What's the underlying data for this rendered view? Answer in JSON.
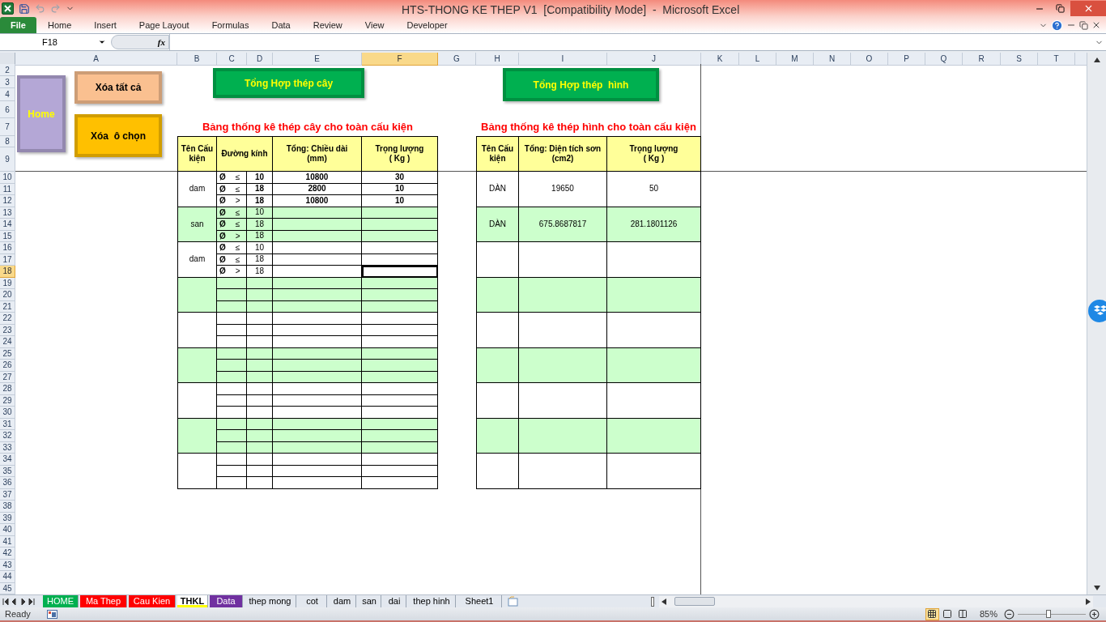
{
  "window": {
    "title": "HTS-THONG KE THEP V1  [Compatibility Mode]  -  Microsoft Excel"
  },
  "ribbon_tabs": [
    {
      "label": "File",
      "kind": "file"
    },
    {
      "label": "Home",
      "kind": "tab"
    },
    {
      "label": "Insert",
      "kind": "tab"
    },
    {
      "label": "Page Layout",
      "kind": "tab"
    },
    {
      "label": "Formulas",
      "kind": "tab"
    },
    {
      "label": "Data",
      "kind": "tab"
    },
    {
      "label": "Review",
      "kind": "tab"
    },
    {
      "label": "View",
      "kind": "tab"
    },
    {
      "label": "Developer",
      "kind": "tab"
    }
  ],
  "formula_bar": {
    "name_box": "F18",
    "function_label": "fx"
  },
  "columns": [
    {
      "label": "A",
      "selected": false
    },
    {
      "label": "B",
      "selected": false
    },
    {
      "label": "C",
      "selected": false
    },
    {
      "label": "D",
      "selected": false
    },
    {
      "label": "E",
      "selected": false
    },
    {
      "label": "F",
      "selected": true
    },
    {
      "label": "G",
      "selected": false
    },
    {
      "label": "H",
      "selected": false
    },
    {
      "label": "I",
      "selected": false
    },
    {
      "label": "J",
      "selected": false
    },
    {
      "label": "K",
      "selected": false
    },
    {
      "label": "L",
      "selected": false
    },
    {
      "label": "M",
      "selected": false
    },
    {
      "label": "N",
      "selected": false
    },
    {
      "label": "O",
      "selected": false
    },
    {
      "label": "P",
      "selected": false
    },
    {
      "label": "Q",
      "selected": false
    },
    {
      "label": "R",
      "selected": false
    },
    {
      "label": "S",
      "selected": false
    },
    {
      "label": "T",
      "selected": false
    }
  ],
  "rows": [
    {
      "label": "2",
      "selected": false
    },
    {
      "label": "3",
      "selected": false
    },
    {
      "label": "4",
      "selected": false
    },
    {
      "label": "6",
      "selected": false
    },
    {
      "label": "7",
      "selected": false
    },
    {
      "label": "8",
      "selected": false
    },
    {
      "label": "9",
      "selected": false
    },
    {
      "label": "10",
      "selected": false
    },
    {
      "label": "11",
      "selected": false
    },
    {
      "label": "12",
      "selected": false
    },
    {
      "label": "13",
      "selected": false
    },
    {
      "label": "14",
      "selected": false
    },
    {
      "label": "15",
      "selected": false
    },
    {
      "label": "16",
      "selected": false
    },
    {
      "label": "17",
      "selected": false
    },
    {
      "label": "18",
      "selected": true
    },
    {
      "label": "19",
      "selected": false
    },
    {
      "label": "20",
      "selected": false
    },
    {
      "label": "21",
      "selected": false
    },
    {
      "label": "22",
      "selected": false
    },
    {
      "label": "23",
      "selected": false
    },
    {
      "label": "24",
      "selected": false
    },
    {
      "label": "25",
      "selected": false
    },
    {
      "label": "26",
      "selected": false
    },
    {
      "label": "27",
      "selected": false
    },
    {
      "label": "28",
      "selected": false
    },
    {
      "label": "29",
      "selected": false
    },
    {
      "label": "30",
      "selected": false
    },
    {
      "label": "31",
      "selected": false
    },
    {
      "label": "32",
      "selected": false
    },
    {
      "label": "33",
      "selected": false
    },
    {
      "label": "34",
      "selected": false
    },
    {
      "label": "35",
      "selected": false
    },
    {
      "label": "36",
      "selected": false
    },
    {
      "label": "37",
      "selected": false
    },
    {
      "label": "38",
      "selected": false
    },
    {
      "label": "39",
      "selected": false
    },
    {
      "label": "40",
      "selected": false
    },
    {
      "label": "41",
      "selected": false
    },
    {
      "label": "42",
      "selected": false
    },
    {
      "label": "43",
      "selected": false
    },
    {
      "label": "44",
      "selected": false
    },
    {
      "label": "45",
      "selected": false
    }
  ],
  "shapes": [
    {
      "label": "Home",
      "color": "#b4a7d6"
    },
    {
      "label": "Xóa tất cả",
      "color": "#fac090"
    },
    {
      "label": "Xóa  ô chọn",
      "color": "#ffc000"
    },
    {
      "label": "Tổng Hợp thép cây",
      "color": "#00b050"
    },
    {
      "label": "Tổng Hợp thép  hình",
      "color": "#00b050"
    }
  ],
  "bar_table": {
    "title": "Bảng thống kê thép cây cho toàn cấu kiện",
    "headers": [
      "Tên Cấu kiện",
      "Đường kính",
      "Tổng: Chiều dài\n(mm)",
      "Trọng lượng\n( Kg )"
    ],
    "groups": [
      {
        "name": "dam",
        "shaded": false,
        "bold": true,
        "rows": [
          {
            "symbol": "Ø",
            "sign": "≤",
            "diameter": "10",
            "length": "10800",
            "weight": "30"
          },
          {
            "symbol": "Ø",
            "sign": "≤",
            "diameter": "18",
            "length": "2800",
            "weight": "10"
          },
          {
            "symbol": "Ø",
            "sign": ">",
            "diameter": "18",
            "length": "10800",
            "weight": "10"
          }
        ]
      },
      {
        "name": "san",
        "shaded": true,
        "bold": false,
        "rows": [
          {
            "symbol": "Ø",
            "sign": "≤",
            "diameter": "10"
          },
          {
            "symbol": "Ø",
            "sign": "≤",
            "diameter": "18"
          },
          {
            "symbol": "Ø",
            "sign": ">",
            "diameter": "18"
          }
        ]
      },
      {
        "name": "dam",
        "shaded": false,
        "bold": false,
        "rows": [
          {
            "symbol": "Ø",
            "sign": "≤",
            "diameter": "10"
          },
          {
            "symbol": "Ø",
            "sign": "≤",
            "diameter": "18"
          },
          {
            "symbol": "Ø",
            "sign": ">",
            "diameter": "18"
          }
        ]
      },
      {
        "shaded": true
      },
      {
        "shaded": false
      },
      {
        "shaded": true
      },
      {
        "shaded": false
      },
      {
        "shaded": true
      },
      {
        "shaded": false
      }
    ]
  },
  "shape_table": {
    "title": "Bảng thống kê thép hình cho toàn cấu kiện",
    "headers": [
      "Tên Cấu kiện",
      "Tổng: Diện tích sơn\n(cm2)",
      "Trọng lượng\n( Kg )"
    ],
    "groups": [
      {
        "name": "DÀN",
        "area": "19650",
        "weight": "50",
        "shaded": false
      },
      {
        "name": "DÀN",
        "area": "675.8687817",
        "weight": "281.1801126",
        "shaded": true
      },
      {
        "shaded": false
      },
      {
        "shaded": true
      },
      {
        "shaded": false
      },
      {
        "shaded": true
      },
      {
        "shaded": false
      },
      {
        "shaded": true
      },
      {
        "shaded": false
      }
    ]
  },
  "sheet_tabs": [
    {
      "label": "HOME",
      "color": "#00b050",
      "selected": false
    },
    {
      "label": "Ma Thep",
      "color": "#ff0000",
      "selected": false
    },
    {
      "label": "Cau Kien",
      "color": "#ff0000",
      "selected": false
    },
    {
      "label": "THKL",
      "color": "#ffff00",
      "selected": true
    },
    {
      "label": "Data",
      "color": "#7030a0",
      "selected": false
    },
    {
      "label": "thep mong",
      "selected": false
    },
    {
      "label": "cot",
      "selected": false
    },
    {
      "label": "dam",
      "selected": false
    },
    {
      "label": "san",
      "selected": false
    },
    {
      "label": "dai",
      "selected": false
    },
    {
      "label": "thep hinh",
      "selected": false
    },
    {
      "label": "Sheet1",
      "selected": false
    }
  ],
  "status_bar": {
    "text": "Ready",
    "views": [
      {
        "kind": "normal",
        "selected": true
      },
      {
        "kind": "page_layout",
        "selected": false
      },
      {
        "kind": "page_break",
        "selected": false
      }
    ],
    "zoom": "85%",
    "zoom_slider": {
      "level": 0.45
    }
  }
}
